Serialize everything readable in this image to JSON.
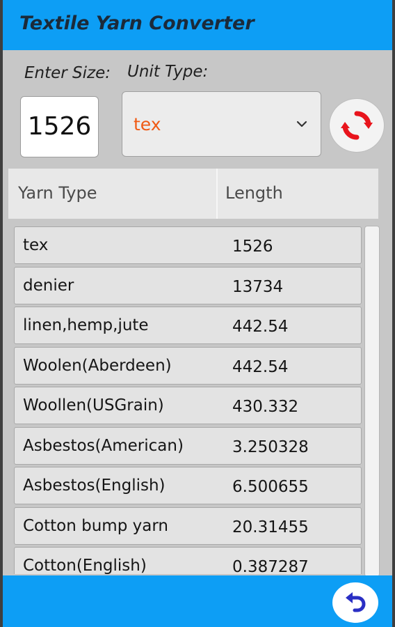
{
  "app": {
    "title": "Textile Yarn Converter"
  },
  "form": {
    "size_label": "Enter Size:",
    "unit_label": "Unit Type:",
    "size_value": "1526",
    "unit_selected": "tex",
    "accent_color": "#f05a14"
  },
  "table": {
    "headers": [
      "Yarn Type",
      "Length"
    ],
    "rows": [
      {
        "type": "tex",
        "value": "1526"
      },
      {
        "type": "denier",
        "value": "13734"
      },
      {
        "type": "linen,hemp,jute",
        "value": "442.54"
      },
      {
        "type": "Woolen(Aberdeen)",
        "value": "442.54"
      },
      {
        "type": "Woollen(USGrain)",
        "value": "430.332"
      },
      {
        "type": "Asbestos(American)",
        "value": "3.250328"
      },
      {
        "type": "Asbestos(English)",
        "value": "6.500655"
      },
      {
        "type": "Cotton bump yarn",
        "value": "20.31455"
      },
      {
        "type": "Cotton(English)",
        "value": "0.387287"
      }
    ]
  },
  "icons": {
    "convert": "refresh-icon",
    "back": "undo-arrow-icon",
    "dropdown": "chevron-down-icon"
  },
  "colors": {
    "primary": "#0d9ef5",
    "convert_icon": "#e8141c",
    "back_icon": "#2a2fc4"
  }
}
